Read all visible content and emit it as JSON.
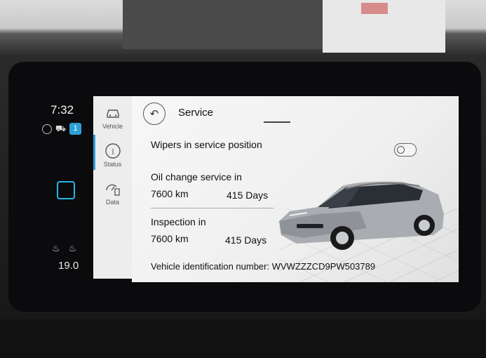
{
  "status_bar": {
    "clock": "7:32",
    "car_glyph": "⛟",
    "notification_badge": "1",
    "temperature": "19.0"
  },
  "side_nav": {
    "items": [
      {
        "label": "Vehicle",
        "icon": "car-icon"
      },
      {
        "label": "Status",
        "icon": "info-icon"
      },
      {
        "label": "Data",
        "icon": "gauge-data-icon"
      }
    ],
    "active_index": 1
  },
  "service": {
    "title": "Service",
    "back_glyph": "↶",
    "wipers_label": "Wipers in service position",
    "wipers_on": false,
    "oil_label": "Oil change service in",
    "oil_km": "7600 km",
    "oil_days": "415 Days",
    "inspection_label": "Inspection in",
    "inspection_km": "7600 km",
    "inspection_days": "415 Days",
    "vin_label": "Vehicle identification number:",
    "vin_value": "WVWZZZCD9PW503789"
  },
  "colors": {
    "accent": "#2ea0d8",
    "screen_bg": "#f2f2f2",
    "nav_bg": "#ededed"
  }
}
